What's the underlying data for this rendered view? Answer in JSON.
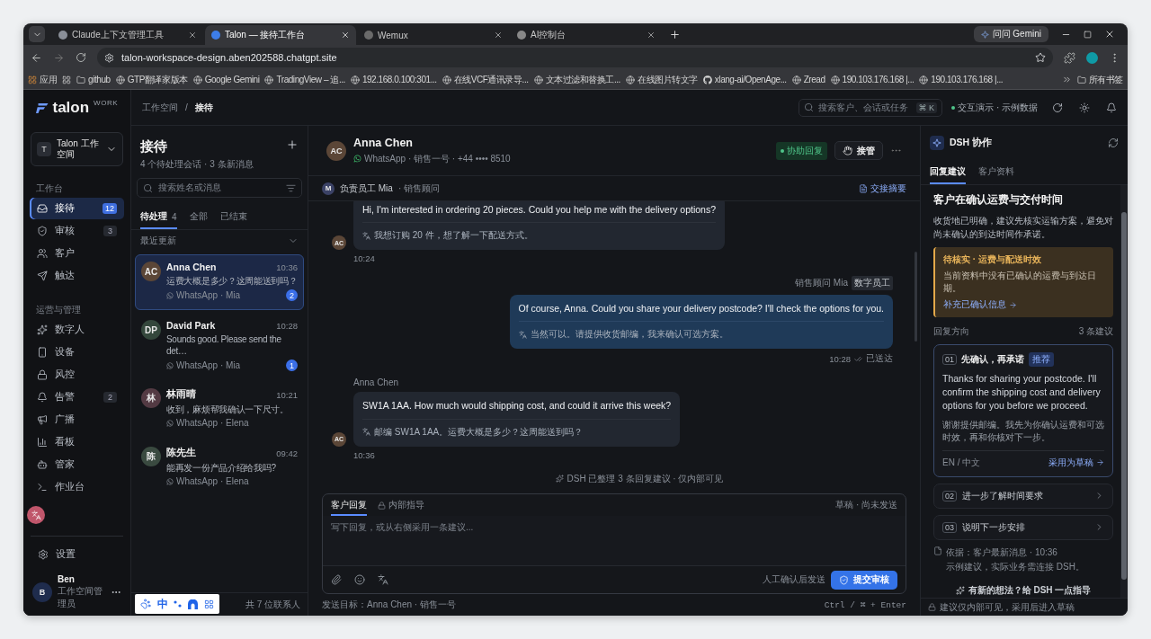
{
  "browser": {
    "tabs": [
      {
        "title": "Claude上下文管理工具",
        "selected": false
      },
      {
        "title": "Talon — 接待工作台",
        "selected": true
      },
      {
        "title": "Wemux",
        "selected": false
      },
      {
        "title": "AI控制台",
        "selected": false
      }
    ],
    "gemini_button": "问问 Gemini",
    "url": "talon-workspace-design.aben202588.chatgpt.site",
    "bookmarks": [
      {
        "label": "应用"
      },
      {
        "label": "github"
      },
      {
        "label": "GTP翻译家版本"
      },
      {
        "label": "Google Gemini"
      },
      {
        "label": "TradingView – 追..."
      },
      {
        "label": "192.168.0.100:301..."
      },
      {
        "label": "在线VCF通讯录导..."
      },
      {
        "label": "文本过滤和替换工..."
      },
      {
        "label": "在线图片转文字"
      },
      {
        "label": "xlang-ai/OpenAge..."
      },
      {
        "label": "Zread"
      },
      {
        "label": "190.103.176.168 |..."
      },
      {
        "label": "190.103.176.168 |..."
      }
    ],
    "all_bookmarks": "所有书签"
  },
  "sidebar": {
    "brand": "talon",
    "brand_tag": "WORK",
    "workspace": {
      "initial": "T",
      "name": "Talon 工作空间"
    },
    "sections": [
      {
        "title": "工作台",
        "items": [
          {
            "label": "接待",
            "count": "12",
            "selected": true
          },
          {
            "label": "审核",
            "count": "3",
            "selected": false
          },
          {
            "label": "客户",
            "selected": false
          },
          {
            "label": "触达",
            "selected": false
          }
        ]
      },
      {
        "title": "运营与管理",
        "items": [
          {
            "label": "数字人",
            "selected": false
          },
          {
            "label": "设备",
            "selected": false
          },
          {
            "label": "风控",
            "selected": false
          },
          {
            "label": "告警",
            "count": "2",
            "selected": false
          },
          {
            "label": "广播",
            "selected": false
          },
          {
            "label": "看板",
            "selected": false
          },
          {
            "label": "管家",
            "selected": false
          },
          {
            "label": "作业台",
            "selected": false
          }
        ]
      }
    ],
    "settings": "设置",
    "user": {
      "initial": "B",
      "name": "Ben",
      "role": "工作空间管理员"
    }
  },
  "topbar": {
    "breadcrumb": [
      "工作空间",
      "接待"
    ],
    "breadcrumb_separator": "/",
    "search": {
      "placeholder": "搜索客户、会话或任务",
      "shortcut": "⌘ K"
    },
    "demo_label": "交互演示 · 示例数据"
  },
  "conversations": {
    "title": "接待",
    "summary": "4 个待处理会话 · 3 条新消息",
    "search_placeholder": "搜索姓名或消息",
    "tabs": [
      {
        "label": "待处理",
        "count": "4",
        "selected": true
      },
      {
        "label": "全部",
        "selected": false
      },
      {
        "label": "已结束",
        "selected": false
      }
    ],
    "sort_label": "最近更新",
    "items": [
      {
        "initials": "AC",
        "color": "#5b4637",
        "name": "Anna Chen",
        "time": "10:36",
        "preview": "运费大概是多少？这周能送到吗？",
        "channel": "WhatsApp · Mia",
        "unread": "2",
        "selected": true
      },
      {
        "initials": "DP",
        "color": "#34473c",
        "name": "David Park",
        "time": "10:28",
        "preview": "Sounds good. Please send the det…",
        "channel": "WhatsApp · Mia",
        "unread": "1",
        "selected": false
      },
      {
        "initials": "林",
        "color": "#533a43",
        "name": "林雨晴",
        "time": "10:21",
        "preview": "收到，麻烦帮我确认一下尺寸。",
        "channel": "WhatsApp · Elena",
        "selected": false
      },
      {
        "initials": "陈",
        "color": "#3a4a40",
        "name": "陈先生",
        "time": "09:42",
        "preview": "能再发一份产品介绍给我吗?",
        "channel": "WhatsApp · Elena",
        "selected": false
      }
    ],
    "footer": "共 7 位联系人"
  },
  "chat": {
    "contact": {
      "initials": "AC",
      "name": "Anna Chen",
      "meta": "WhatsApp · 销售一号 · +44 •••• 8510"
    },
    "status": "协助回复",
    "takeover": "接管",
    "owner": {
      "initial": "M",
      "name": "负责员工 Mia",
      "role": "· 销售顾问"
    },
    "handoff": "交接摘要",
    "messages": [
      {
        "kind": "incoming",
        "avatar": "AC",
        "text": "Hi, I'm interested in ordering 20 pieces. Could you help me with the delivery options?",
        "translation": "我想订购 20 件，想了解一下配送方式。",
        "time": "10:24"
      },
      {
        "kind": "outgoing",
        "sender": "销售顾问 Mia",
        "sender_badge": "数字员工",
        "text": "Of course, Anna. Could you share your delivery postcode? I'll check the options for you.",
        "translation": "当然可以。请提供收货邮编，我来确认可选方案。",
        "time": "10:28",
        "status": "已送达"
      },
      {
        "kind": "incoming",
        "avatar": "AC",
        "sender": "Anna Chen",
        "text": "SW1A 1AA. How much would shipping cost, and could it arrive this week?",
        "translation": "邮编 SW1A 1AA。运费大概是多少？这周能送到吗？",
        "time": "10:36"
      }
    ],
    "system_note": "DSH 已整理 3 条回复建议 · 仅内部可见",
    "composer": {
      "tabs": [
        {
          "label": "客户回复",
          "selected": true
        },
        {
          "label": "内部指导",
          "selected": false
        }
      ],
      "draft_status": "草稿 · 尚未发送",
      "placeholder": "写下回复，或从右侧采用一条建议...",
      "hint": "人工确认后发送",
      "submit": "提交审核"
    },
    "target": "发送目标：Anna Chen · 销售一号",
    "shortcut": "Ctrl / ⌘ + Enter"
  },
  "assistant": {
    "title": "DSH 协作",
    "tabs": [
      {
        "label": "回复建议",
        "selected": true
      },
      {
        "label": "客户资料",
        "selected": false
      }
    ],
    "summary_title": "客户在确认运费与交付时间",
    "summary_text": "收货地已明确，建议先核实运输方案，避免对尚未确认的到达时间作承诺。",
    "alert": {
      "title": "待核实 · 运费与配送时效",
      "text": "当前资料中没有已确认的运费与到达日期。",
      "link": "补充已确认信息"
    },
    "directions_label": "回复方向",
    "directions_count": "3 条建议",
    "suggestions": [
      {
        "number": "01",
        "title": "先确认，再承诺",
        "badge": "推荐",
        "expanded": true,
        "text_en": "Thanks for sharing your postcode. I'll confirm the shipping cost and delivery options for you before we proceed.",
        "text_zh": "谢谢提供邮编。我先为你确认运费和可选时效，再和你核对下一步。",
        "languages": "EN / 中文",
        "action": "采用为草稿"
      },
      {
        "number": "02",
        "title": "进一步了解时间要求",
        "expanded": false
      },
      {
        "number": "03",
        "title": "说明下一步安排",
        "expanded": false
      }
    ],
    "basis": "依据：客户最新消息 · 10:36",
    "disclaimer": "示例建议，实际业务需连接 DSH。",
    "guide": "有新的想法？给 DSH 一点指导",
    "footer": "建议仅内部可见，采用后进入草稿"
  },
  "ime": {
    "mode": "中"
  }
}
